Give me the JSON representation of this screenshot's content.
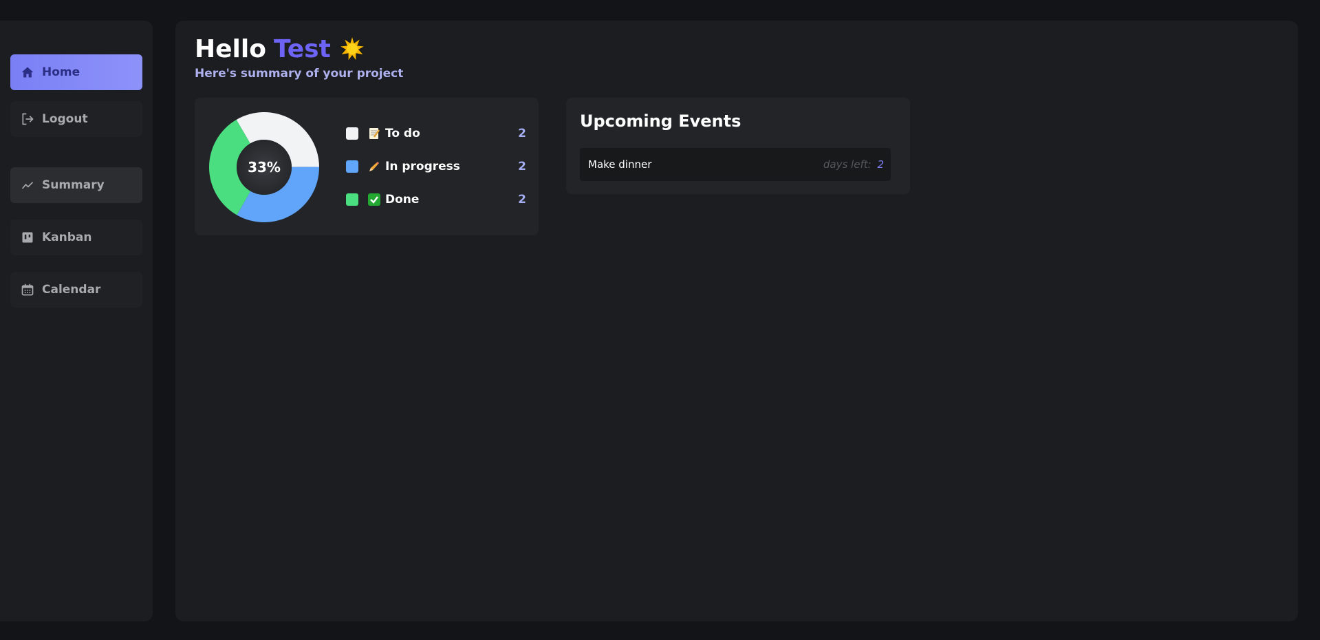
{
  "sidebar": {
    "items": [
      {
        "label": "Home",
        "icon": "home-icon"
      },
      {
        "label": "Logout",
        "icon": "logout-icon"
      },
      {
        "label": "Summary",
        "icon": "trending-icon"
      },
      {
        "label": "Kanban",
        "icon": "kanban-icon"
      },
      {
        "label": "Calendar",
        "icon": "calendar-icon"
      }
    ]
  },
  "header": {
    "greeting": "Hello",
    "user_name": "Test",
    "greeting_icon": "sun-icon",
    "subtitle": "Here's summary of your project"
  },
  "summary": {
    "percent_label": "33%",
    "legend": [
      {
        "label": "To do",
        "count": "2",
        "icon": "memo-icon",
        "color": "#f2f3f5"
      },
      {
        "label": "In progress",
        "count": "2",
        "icon": "pencil-icon",
        "color": "#60a5fa"
      },
      {
        "label": "Done",
        "count": "2",
        "icon": "check-mark-icon",
        "color": "#4ade80"
      }
    ]
  },
  "events": {
    "title": "Upcoming Events",
    "items": [
      {
        "name": "Make dinner",
        "days_label": "days left:",
        "days": "2"
      }
    ]
  },
  "chart_data": {
    "type": "pie",
    "categories": [
      "To do",
      "In progress",
      "Done"
    ],
    "values": [
      2,
      2,
      2
    ],
    "colors": [
      "#f2f3f5",
      "#60a5fa",
      "#4ade80"
    ],
    "center_label": "33%"
  },
  "colors": {
    "accent": "#7a80f4",
    "name_highlight": "#6d63f5",
    "count": "#a6adf7",
    "background": "#131418",
    "panel": "#1c1d20",
    "card": "#222427"
  }
}
